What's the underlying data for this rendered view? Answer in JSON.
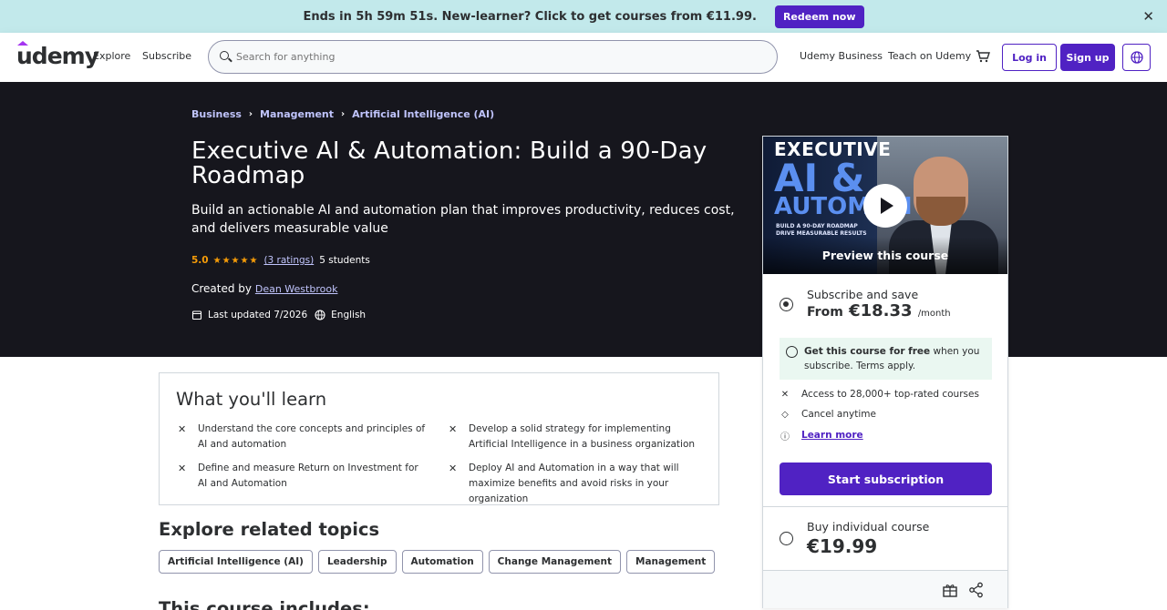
{
  "promo": {
    "text": "Ends in 5h 59m 51s. New-learner? Click to get courses from €11.99.",
    "button": "Redeem now",
    "close": "✕"
  },
  "header": {
    "logo": "udemy",
    "explore": "Explore",
    "subscribe": "Subscribe",
    "search_placeholder": "Search for anything",
    "business": "Udemy Business",
    "teach": "Teach on Udemy",
    "login": "Log in",
    "signup": "Sign up"
  },
  "breadcrumb": [
    "Business",
    "Management",
    "Artificial Intelligence (AI)"
  ],
  "course": {
    "title": "Executive AI & Automation: Build a 90-Day Roadmap",
    "subtitle": "Build an actionable AI and automation plan that improves productivity, reduces cost, and delivers measurable value",
    "rating": "5.0",
    "stars": "★★★★★",
    "ratings_count": "(3 ratings)",
    "students": "5 students",
    "created_by_label": "Created by",
    "author": "Dean Westbrook",
    "last_updated": "Last updated 7/2026",
    "language": "English"
  },
  "preview": {
    "line1": "EXECUTIVE",
    "line2": "AI &",
    "line3": "AUTOMATI",
    "line4": "BUILD A 90-DAY ROADMAP DRIVE MEASURABLE RESULTS",
    "label": "Preview this course"
  },
  "card": {
    "subscribe_title": "Subscribe and save",
    "subscribe_price_prefix": "From",
    "subscribe_price": "€18.33",
    "subscribe_period": "/month",
    "free_bold": "Get this course for free",
    "free_rest": " when you subscribe. Terms apply.",
    "perk1": "Access to 28,000+ top-rated courses",
    "perk2": "Cancel anytime",
    "perk3": "Learn more",
    "start_button": "Start subscription",
    "buy_title": "Buy individual course",
    "buy_price": "€19.99"
  },
  "learn": {
    "title": "What you'll learn",
    "items": [
      "Understand the core concepts and principles of AI and automation",
      "Develop a solid strategy for implementing Artificial Intelligence in a business organization",
      "Define and measure Return on Investment for AI and Automation",
      "Deploy AI and Automation in a way that will maximize benefits and avoid risks in your organization"
    ]
  },
  "related": {
    "title": "Explore related topics",
    "topics": [
      "Artificial Intelligence (AI)",
      "Leadership",
      "Automation",
      "Change Management",
      "Management"
    ]
  },
  "includes": {
    "title": "This course includes:"
  },
  "colors": {
    "accent": "#5022c3",
    "banner": "#c2e9eb",
    "hero": "#16161d",
    "star": "#f69c08",
    "link_light": "#c0c4fc"
  }
}
